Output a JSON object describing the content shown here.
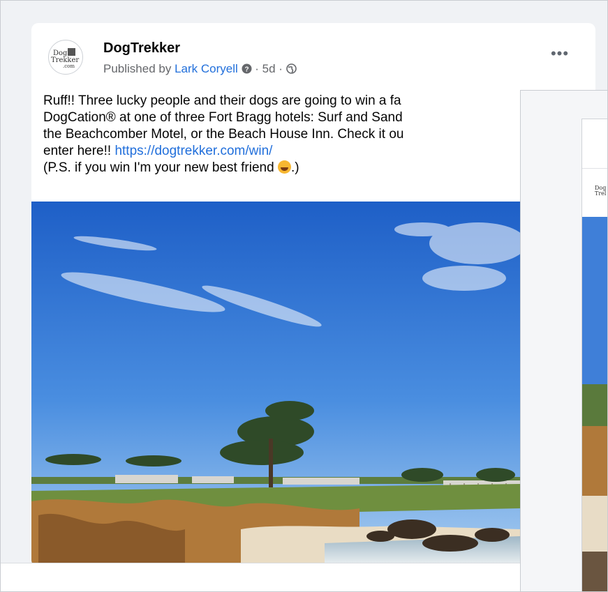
{
  "post": {
    "page_name": "DogTrekker",
    "published_by_prefix": "Published by ",
    "published_by_name": "Lark Coryell",
    "time": "5d",
    "separator": " · ",
    "more_label": "•••",
    "avatar_text_line1": "Dog",
    "avatar_text_line2": "Trekker",
    "avatar_text_line3": ".com",
    "body_lines": [
      "Ruff!! Three lucky people and their dogs are going to win a fa",
      "DogCation® at one of three Fort Bragg hotels: Surf and Sand",
      "the Beachcomber Motel, or the Beach House Inn. Check it ou",
      "enter here!! "
    ],
    "url": "https://dogtrekker.com/win/",
    "ps_prefix": "(P.S. if you win I'm your new best friend ",
    "ps_suffix": ".)"
  },
  "overlay": {
    "logo_line1": "Dog",
    "logo_line2": "Trel"
  },
  "icons": {
    "help": "question-circle-icon",
    "globe": "globe-icon",
    "emoji": "rolling-laughing-emoji-icon"
  }
}
